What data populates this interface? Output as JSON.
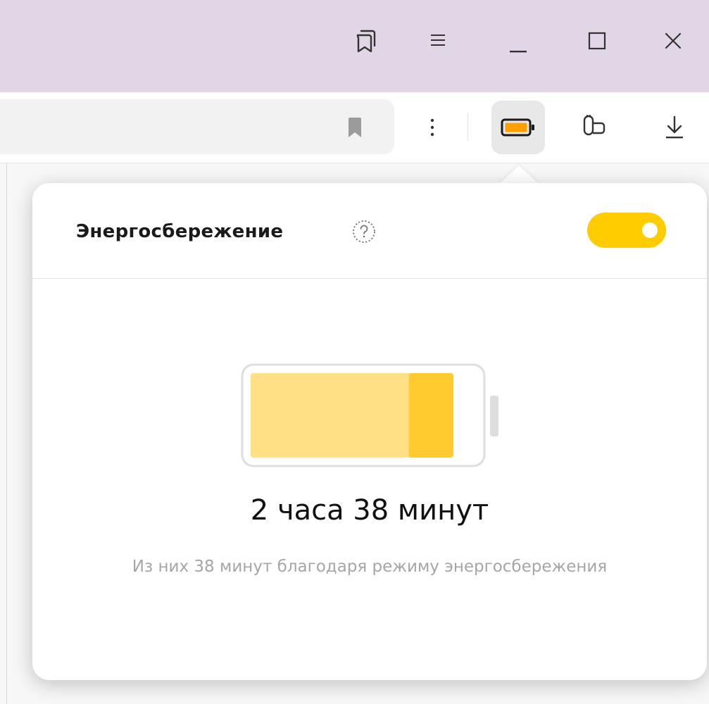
{
  "popup": {
    "title": "Энергосбережение",
    "toggle_on": true,
    "time_remaining": "2 часа 38 минут",
    "saved_note": "Из них 38 минут благодаря режиму энергосбережения",
    "battery_level": 0.9,
    "saved_fraction": 0.22
  },
  "icons": {
    "tabs": "tabs-icon",
    "menu": "menu-icon",
    "minimize": "minimize-icon",
    "maximize": "maximize-icon",
    "close": "close-icon",
    "bookmark": "bookmark-icon",
    "more": "more-vertical-icon",
    "battery": "battery-icon",
    "protect": "protect-icon",
    "download": "download-icon",
    "help": "help-icon"
  },
  "colors": {
    "accent": "#ffcc00",
    "battery_base": "#ffe085",
    "battery_saved": "#ffcb2e",
    "toolbar_battery": "#ff9f00",
    "titlebar": "#e0d6e6"
  }
}
